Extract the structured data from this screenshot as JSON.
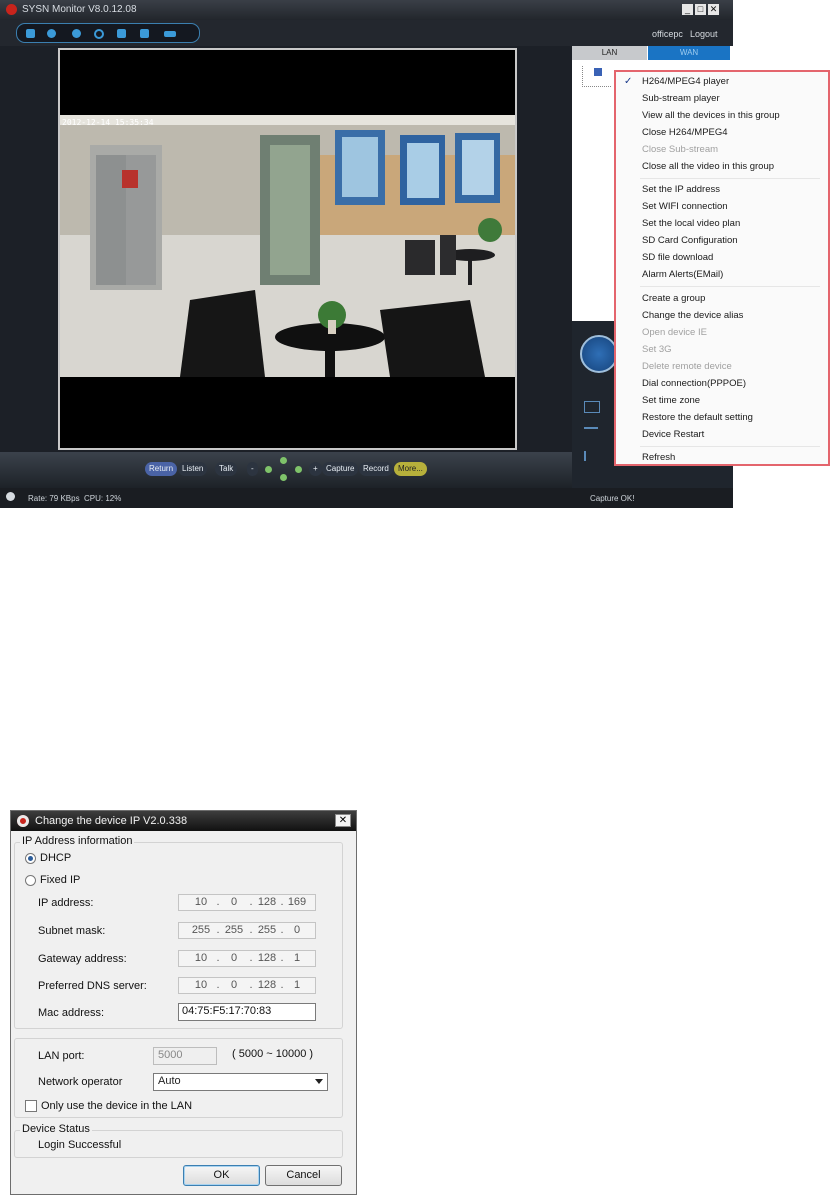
{
  "monitor": {
    "title": "SYSN Monitor  V8.0.12.08",
    "user": "officepc",
    "logout": "Logout",
    "camera_timestamp": "2012-12-14 15:35:34",
    "controls": {
      "return": "Return",
      "listen": "Listen",
      "talk": "Talk",
      "minus": "-",
      "plus": "+",
      "capture": "Capture",
      "record": "Record",
      "more": "More..."
    },
    "status": {
      "rate": "Rate: 79 KBps",
      "cpu": "CPU: 12%",
      "capture": "Capture OK!"
    },
    "tabs": {
      "lan": "LAN",
      "wan": "WAN"
    },
    "context_menu": [
      {
        "label": "H264/MPEG4 player",
        "checked": true,
        "enabled": true
      },
      {
        "label": "Sub-stream player",
        "enabled": true
      },
      {
        "label": "View all the devices in this group",
        "enabled": true
      },
      {
        "label": "Close H264/MPEG4",
        "enabled": true
      },
      {
        "label": "Close Sub-stream",
        "enabled": false
      },
      {
        "label": "Close all the video in this group",
        "enabled": true
      },
      {
        "label": "Set the IP address",
        "enabled": true
      },
      {
        "label": "Set WIFI connection",
        "enabled": true
      },
      {
        "label": "Set the local video plan",
        "enabled": true
      },
      {
        "label": "SD Card Configuration",
        "enabled": true
      },
      {
        "label": "SD file download",
        "enabled": true
      },
      {
        "label": "Alarm Alerts(EMail)",
        "enabled": true
      },
      {
        "label": "Create a group",
        "enabled": true
      },
      {
        "label": "Change the device alias",
        "enabled": true
      },
      {
        "label": "Open device IE",
        "enabled": false
      },
      {
        "label": "Set 3G",
        "enabled": false
      },
      {
        "label": "Delete remote device",
        "enabled": false
      },
      {
        "label": "Dial connection(PPPOE)",
        "enabled": true
      },
      {
        "label": "Set time zone",
        "enabled": true
      },
      {
        "label": "Restore the default setting",
        "enabled": true
      },
      {
        "label": "Device Restart",
        "enabled": true
      },
      {
        "label": "Refresh",
        "enabled": true
      }
    ]
  },
  "dialog": {
    "title": "Change the device IP   V2.0.338",
    "close": "✕",
    "ip_group_label": "IP Address information",
    "dhcp_label": "DHCP",
    "fixed_ip_label": "Fixed IP",
    "ip_label": "IP address:",
    "ip": [
      "10",
      "0",
      "128",
      "169"
    ],
    "subnet_label": "Subnet mask:",
    "subnet": [
      "255",
      "255",
      "255",
      "0"
    ],
    "gateway_label": "Gateway address:",
    "gateway": [
      "10",
      "0",
      "128",
      "1"
    ],
    "dns_label": "Preferred DNS server:",
    "dns": [
      "10",
      "0",
      "128",
      "1"
    ],
    "mac_label": "Mac address:",
    "mac": "04:75:F5:17:70:83",
    "lan_port_label": "LAN port:",
    "lan_port": "5000",
    "lan_port_range": "( 5000 ~ 10000 )",
    "operator_label": "Network operator",
    "operator": "Auto",
    "lan_only_label": "Only use the device in the LAN",
    "status_group_label": "Device Status",
    "status_text": "Login Successful",
    "ok": "OK",
    "cancel": "Cancel",
    "ip_dot": "."
  }
}
